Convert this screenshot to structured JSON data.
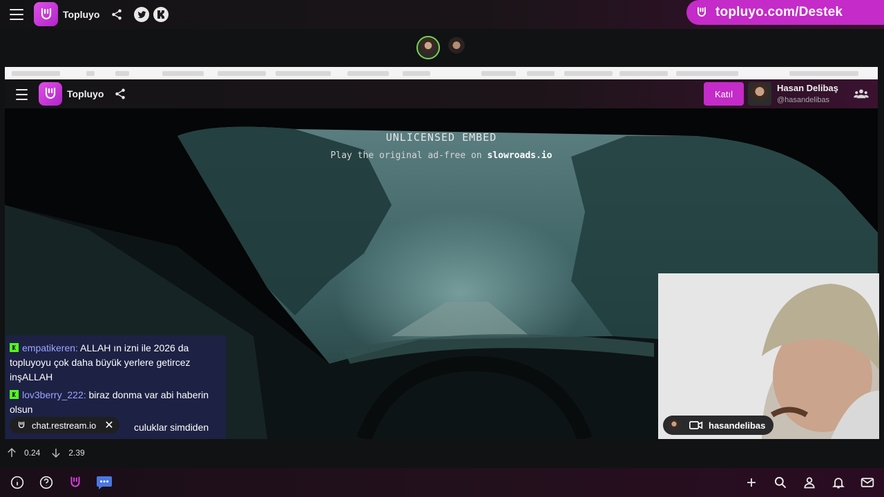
{
  "topbar": {
    "brand": "Topluyo",
    "destek_text": "topluyo.com/Destek"
  },
  "embed": {
    "brand": "Topluyo",
    "join_label": "Katıl",
    "streamer_name": "Hasan Delibaş",
    "streamer_handle": "@hasandelibas",
    "title": "UNLICENSED EMBED",
    "sub_prefix": "Play the original ad-free on",
    "sub_site": "slowroads.io"
  },
  "chat": {
    "messages": [
      {
        "user": "empatikeren:",
        "text": " ALLAH ın izni ile 2026 da topluyoyu çok daha büyük yerlere getircez inşALLAH"
      },
      {
        "user": "lov3berry_222:",
        "text": " biraz donma var abi haberin olsun"
      },
      {
        "user": "",
        "text": "culuklar simdiden"
      }
    ],
    "source": "chat.restream.io"
  },
  "webcam": {
    "label": "hasandelibas"
  },
  "stats": {
    "up": "0.24",
    "down": "2.39"
  },
  "colors": {
    "accent": "#c42bc8",
    "active_ring": "#7bd34a",
    "chat_bg": "#1e2246",
    "kick_green": "#53fc18"
  }
}
